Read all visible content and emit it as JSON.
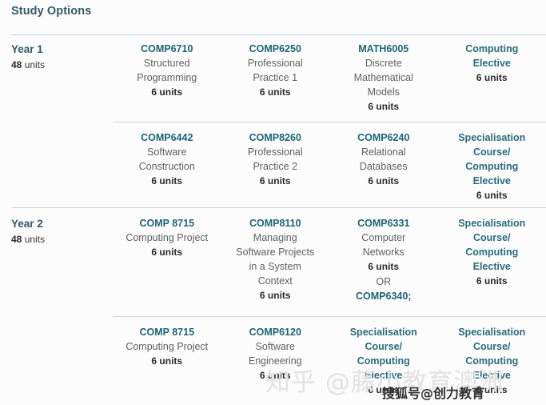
{
  "header": {
    "title": "Study Options"
  },
  "colors": {
    "heading": "#35596b",
    "course_code": "#1d6478",
    "course_name": "#5e6063",
    "units": "#2b2b2b",
    "elective": "#2a6b7c",
    "divider": "#c8d7dd",
    "background": "#fcfcfc"
  },
  "rows": [
    {
      "year_label": "Year 1",
      "year_units_value": "48",
      "year_units_word": "units",
      "courses": [
        {
          "code": "COMP6710",
          "name_lines": [
            "Structured",
            "Programming"
          ],
          "units": "6 units",
          "is_elective": false
        },
        {
          "code": "COMP6250",
          "name_lines": [
            "Professional",
            "Practice 1"
          ],
          "units": "6 units",
          "is_elective": false
        },
        {
          "code": "MATH6005",
          "name_lines": [
            "Discrete",
            "Mathematical",
            "Models"
          ],
          "units": "6 units",
          "is_elective": false
        },
        {
          "code": "",
          "elective_lines": [
            "Computing",
            "Elective"
          ],
          "units": "6 units",
          "is_elective": true
        }
      ]
    },
    {
      "year_label": "",
      "year_units_value": "",
      "year_units_word": "",
      "courses": [
        {
          "code": "COMP6442",
          "name_lines": [
            "Software",
            "Construction"
          ],
          "units": "6 units",
          "is_elective": false
        },
        {
          "code": "COMP8260",
          "name_lines": [
            "Professional",
            "Practice 2"
          ],
          "units": "6 units",
          "is_elective": false
        },
        {
          "code": "COMP6240",
          "name_lines": [
            "Relational",
            "Databases"
          ],
          "units": "6 units",
          "is_elective": false
        },
        {
          "code": "",
          "elective_lines": [
            "Specialisation",
            "Course/",
            "Computing",
            "Elective"
          ],
          "units": "6 units",
          "is_elective": true
        }
      ]
    },
    {
      "year_label": "Year 2",
      "year_units_value": "48",
      "year_units_word": "units",
      "courses": [
        {
          "code": "COMP 8715",
          "name_lines": [
            "Computing Project"
          ],
          "units": "6 units",
          "is_elective": false
        },
        {
          "code": "COMP8110",
          "name_lines": [
            "Managing",
            "Software Projects",
            "in a System",
            "Context"
          ],
          "units": "6 units",
          "is_elective": false
        },
        {
          "code": "COMP6331",
          "name_lines": [
            "Computer",
            "Networks"
          ],
          "units": "6 units",
          "or_word": "OR",
          "alt_code": "COMP6340;",
          "is_elective": false
        },
        {
          "code": "",
          "elective_lines": [
            "Specialisation",
            "Course/",
            "Computing",
            "Elective"
          ],
          "units": "6 units",
          "is_elective": true
        }
      ]
    },
    {
      "year_label": "",
      "year_units_value": "",
      "year_units_word": "",
      "courses": [
        {
          "code": "COMP 8715",
          "name_lines": [
            "Computing Project"
          ],
          "units": "6 units",
          "is_elective": false
        },
        {
          "code": "COMP6120",
          "name_lines": [
            "Software",
            "Engineering"
          ],
          "units": "6 units",
          "is_elective": false
        },
        {
          "code": "",
          "elective_lines": [
            "Specialisation",
            "Course/",
            "Computing",
            "Elective"
          ],
          "units": "6 units",
          "is_elective": true
        },
        {
          "code": "",
          "elective_lines": [
            "Specialisation",
            "Course/",
            "Computing",
            "Elective"
          ],
          "units": "6 units",
          "is_elective": true
        }
      ]
    }
  ],
  "watermarks": {
    "zhihu": "知乎 @藤小教育澳洲",
    "sohu": "搜狐号@创力教育"
  }
}
